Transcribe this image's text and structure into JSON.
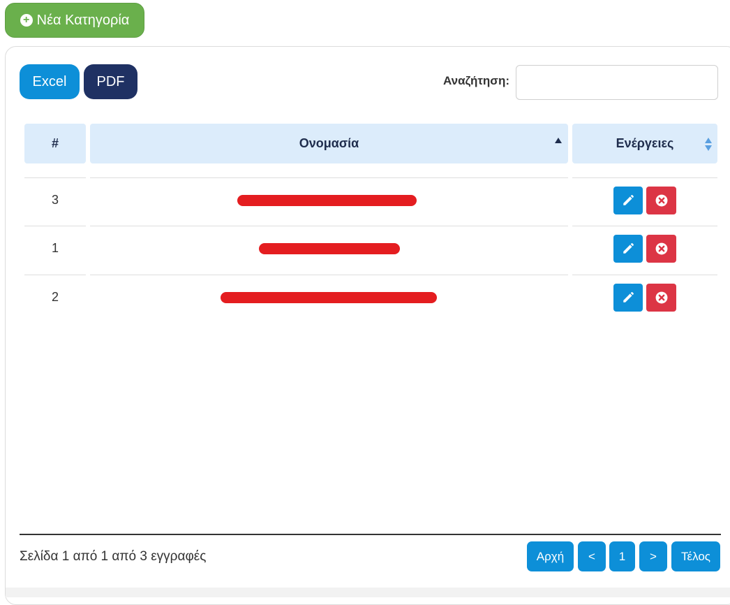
{
  "new_category_label": "Νέα Κατηγορία",
  "export": {
    "excel_label": "Excel",
    "pdf_label": "PDF"
  },
  "search": {
    "label": "Αναζήτηση:",
    "value": ""
  },
  "table": {
    "headers": {
      "num": "#",
      "name": "Ονομασία",
      "actions": "Ενέργειες"
    },
    "rows": [
      {
        "id": "3",
        "name": ""
      },
      {
        "id": "1",
        "name": ""
      },
      {
        "id": "2",
        "name": ""
      }
    ]
  },
  "footer": {
    "info": "Σελίδα 1 από 1 από 3 εγγραφές",
    "first_label": "Αρχή",
    "prev_label": "<",
    "page_label": "1",
    "next_label": ">",
    "last_label": "Τέλος"
  },
  "colors": {
    "primary": "#0d8fd8",
    "success": "#6ab04c",
    "danger": "#dc3545",
    "dark_blue": "#1f3163",
    "header_bg": "#dcecfb"
  },
  "icons": {
    "new": "plus-circle-icon",
    "edit": "pencil-icon",
    "delete": "x-circle-icon",
    "sort_asc": "sort-asc-icon",
    "sort_both": "sort-both-icon"
  }
}
